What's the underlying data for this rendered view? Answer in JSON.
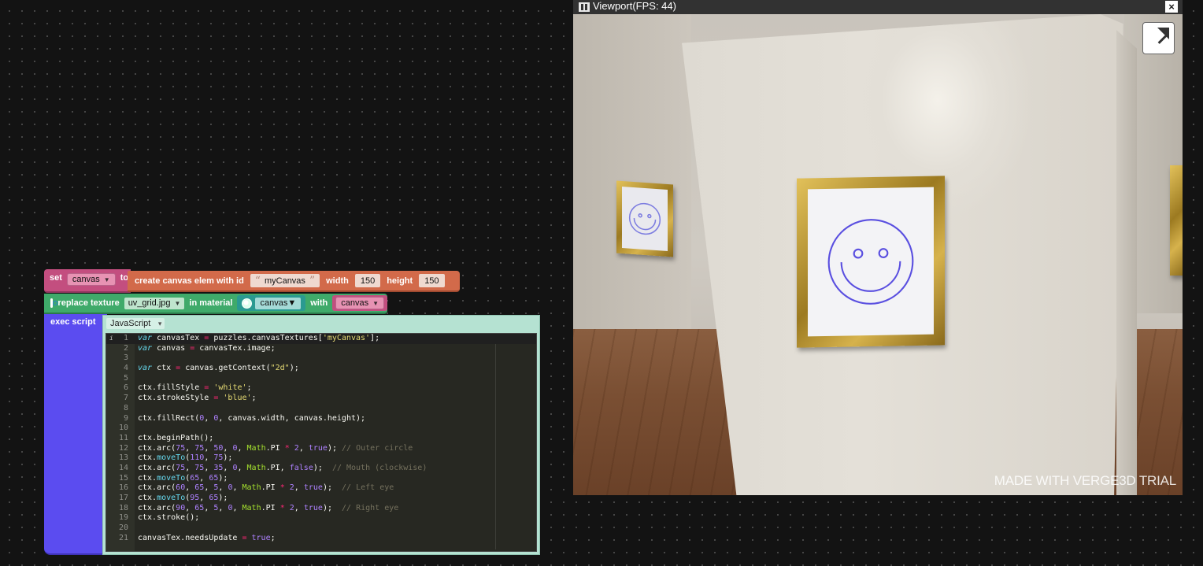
{
  "puzzles": {
    "set_block": {
      "label": "set",
      "variable": "canvas",
      "to_label": "to"
    },
    "create_block": {
      "label": "create canvas elem with id",
      "id_value": "myCanvas",
      "width_label": "width",
      "width_value": "150",
      "height_label": "height",
      "height_value": "150"
    },
    "replace_block": {
      "label": "replace texture",
      "texture": "uv_grid.jpg",
      "material_label": "in material",
      "material": "canvas",
      "with_label": "with",
      "with_variable": "canvas"
    },
    "exec_block": {
      "label": "exec script",
      "language": "JavaScript"
    }
  },
  "code_lines": [
    "var canvasTex = puzzles.canvasTextures['myCanvas'];",
    "var canvas = canvasTex.image;",
    "",
    "var ctx = canvas.getContext(\"2d\");",
    "",
    "ctx.fillStyle = 'white';",
    "ctx.strokeStyle = 'blue';",
    "",
    "ctx.fillRect(0, 0, canvas.width, canvas.height);",
    "",
    "ctx.beginPath();",
    "ctx.arc(75, 75, 50, 0, Math.PI * 2, true); // Outer circle",
    "ctx.moveTo(110, 75);",
    "ctx.arc(75, 75, 35, 0, Math.PI, false);  // Mouth (clockwise)",
    "ctx.moveTo(65, 65);",
    "ctx.arc(60, 65, 5, 0, Math.PI * 2, true);  // Left eye",
    "ctx.moveTo(95, 65);",
    "ctx.arc(90, 65, 5, 0, Math.PI * 2, true);  // Right eye",
    "ctx.stroke();",
    "",
    "canvasTex.needsUpdate = true;"
  ],
  "viewport": {
    "title": "Viewport(FPS: 44)",
    "close_label": "×",
    "watermark": "MADE WITH VERGE3D TRIAL",
    "icons": {
      "pause": "pause-icon",
      "close": "close-icon",
      "fullscreen": "fullscreen-icon"
    }
  },
  "colors": {
    "stroke": "blue",
    "fill": "white"
  }
}
